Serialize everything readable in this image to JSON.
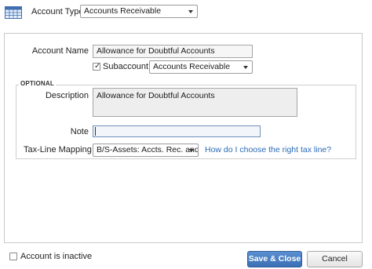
{
  "header": {
    "account_type_label": "Account Type",
    "account_type_value": "Accounts Receivable"
  },
  "form": {
    "account_name_label": "Account Name",
    "account_name_value": "Allowance for Doubtful Accounts",
    "subaccount_checked": true,
    "subaccount_label": "Subaccount of",
    "subaccount_value": "Accounts Receivable"
  },
  "optional": {
    "section_label": "OPTIONAL",
    "description_label": "Description",
    "description_value": "Allowance for Doubtful Accounts",
    "note_label": "Note",
    "note_value": "",
    "tax_line_label": "Tax-Line Mapping",
    "tax_line_value": "B/S-Assets: Accts. Rec. and tr...",
    "help_link": "How do I choose the right tax line?"
  },
  "footer": {
    "inactive_label": "Account is inactive",
    "inactive_checked": false,
    "save_close_label": "Save & Close",
    "cancel_label": "Cancel"
  }
}
